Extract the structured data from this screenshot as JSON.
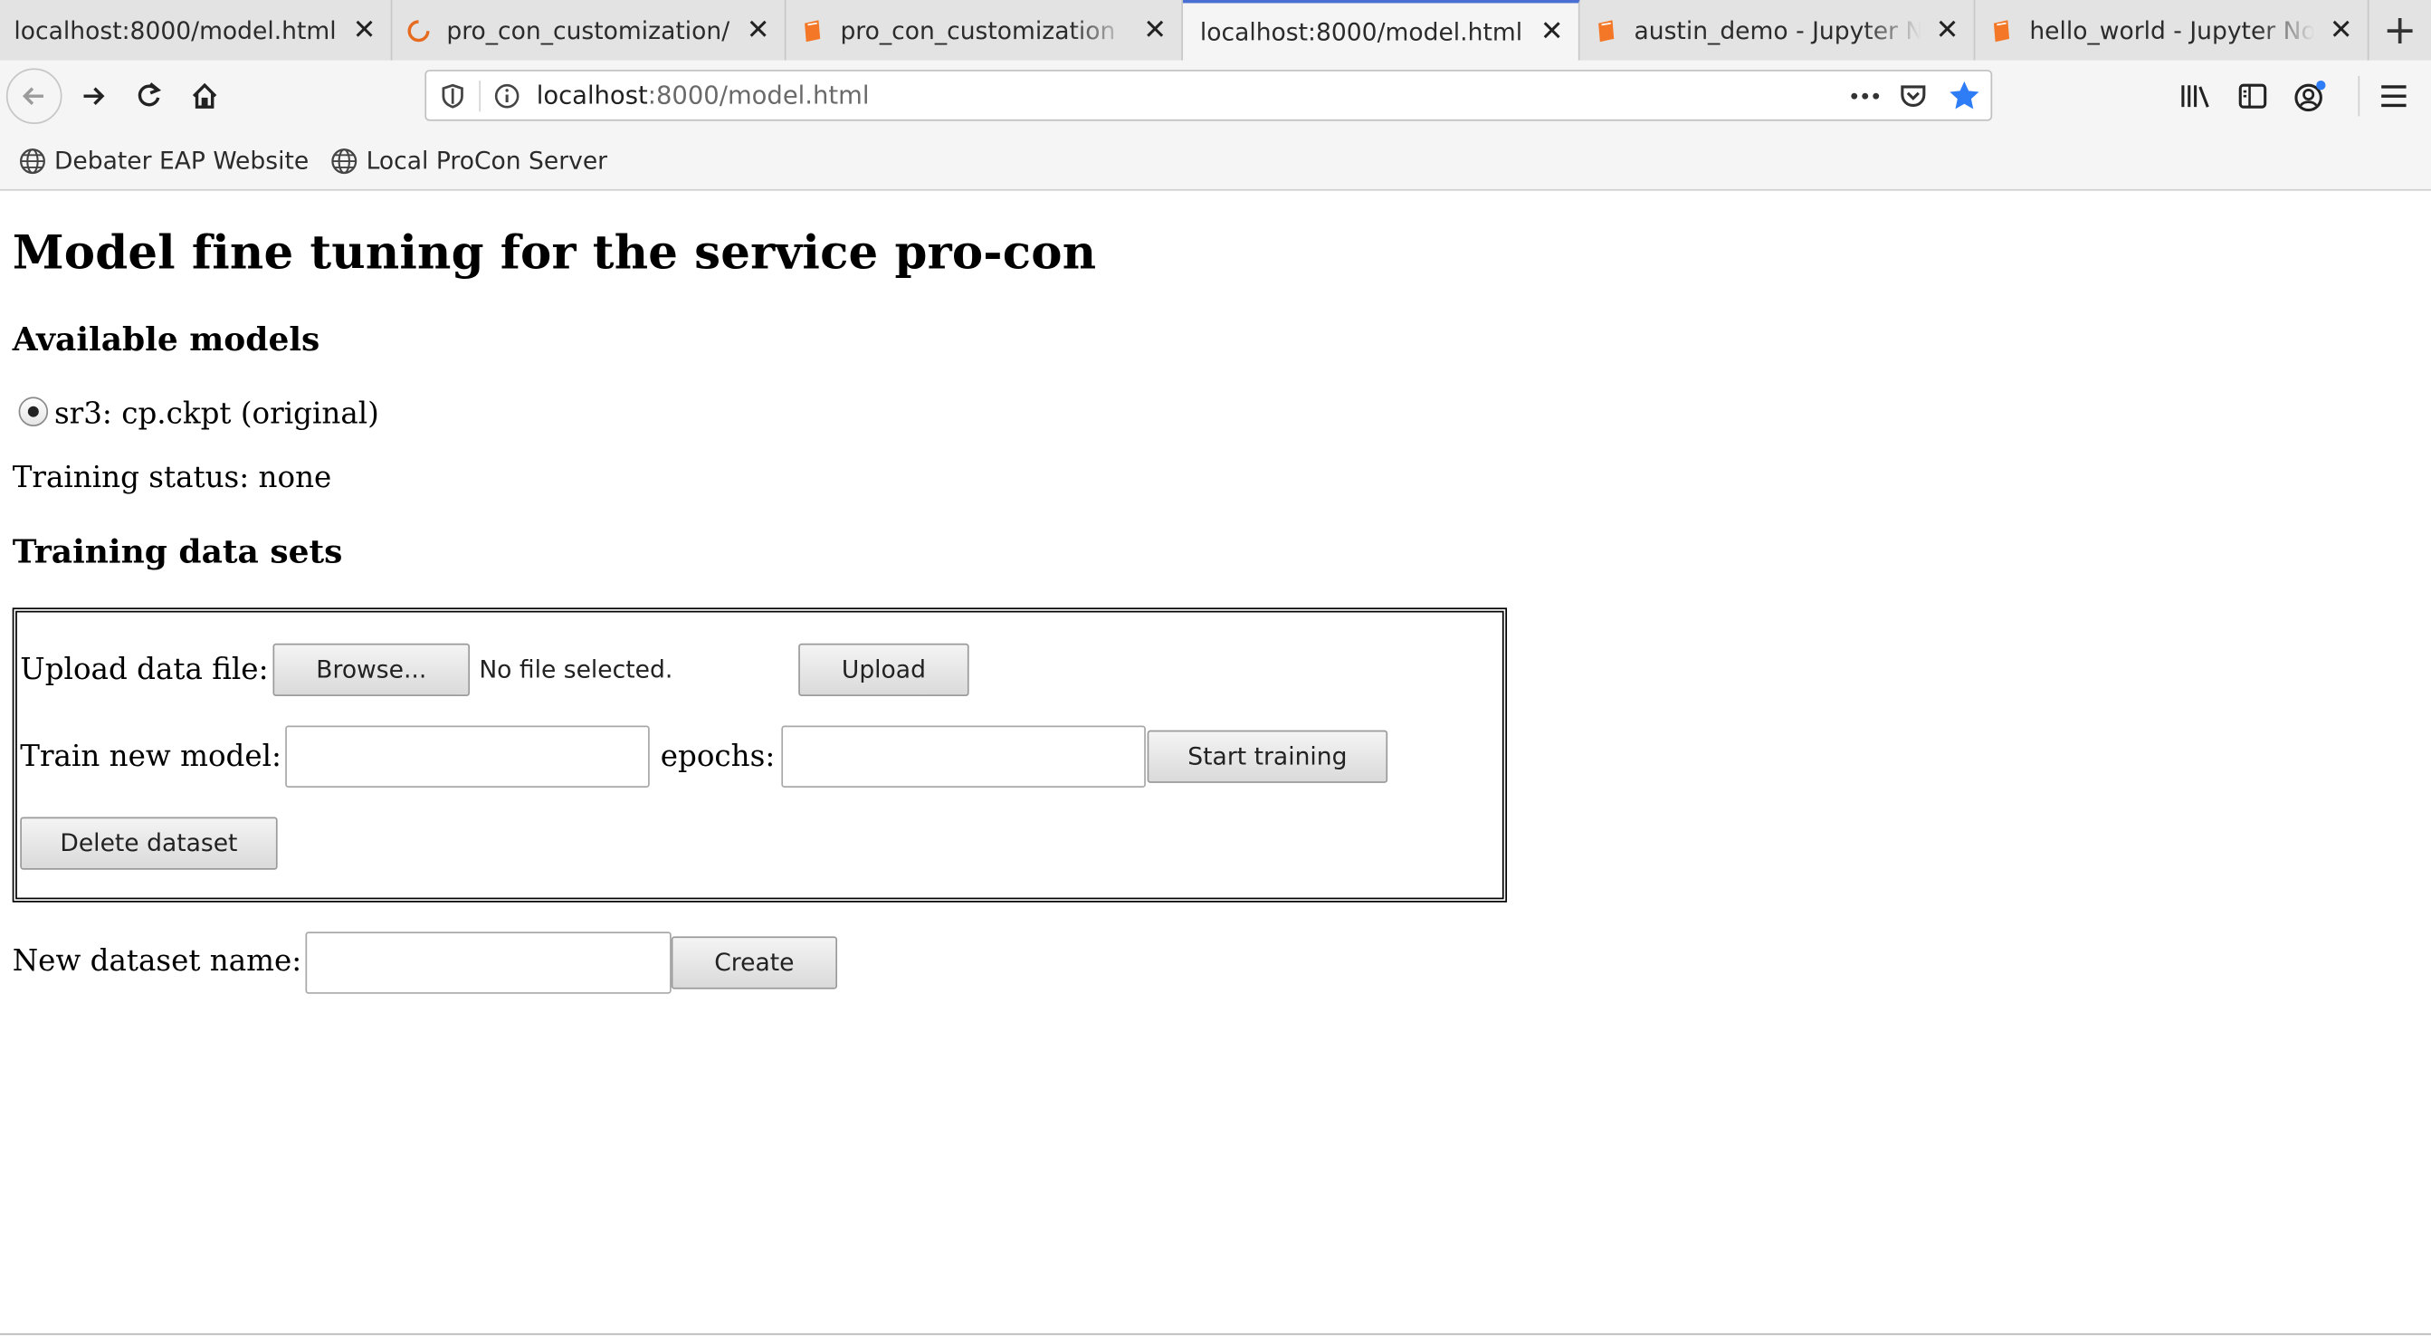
{
  "tabs": [
    {
      "title": "localhost:8000/model.html",
      "icon": "none",
      "active": false
    },
    {
      "title": "pro_con_customization/",
      "icon": "loading-spinner-icon",
      "active": false
    },
    {
      "title": "pro_con_customization",
      "icon": "notebook-icon",
      "active": false
    },
    {
      "title": "localhost:8000/model.html",
      "icon": "none",
      "active": true
    },
    {
      "title": "austin_demo - Jupyter N",
      "icon": "notebook-icon",
      "active": false
    },
    {
      "title": "hello_world - Jupyter No",
      "icon": "notebook-icon",
      "active": false
    }
  ],
  "url": {
    "host": "localhost",
    "path": ":8000/model.html"
  },
  "bookmarks": [
    {
      "label": "Debater EAP Website"
    },
    {
      "label": "Local ProCon Server"
    }
  ],
  "page": {
    "title": "Model fine tuning for the service pro-con",
    "models_heading": "Available models",
    "model_option": "sr3: cp.ckpt (original)",
    "training_status": "Training status: none",
    "datasets_heading": "Training data sets",
    "upload_label": "Upload data file:",
    "browse_button": "Browse...",
    "no_file_text": "No file selected.",
    "upload_button": "Upload",
    "train_label": "Train new model:",
    "epochs_label": "epochs:",
    "start_training_button": "Start training",
    "delete_dataset_button": "Delete dataset",
    "new_dataset_label": "New dataset name:",
    "create_button": "Create"
  },
  "colors": {
    "accent": "#4a6fd3",
    "notebook_icon": "#f37726",
    "star": "#2e7cf6"
  }
}
